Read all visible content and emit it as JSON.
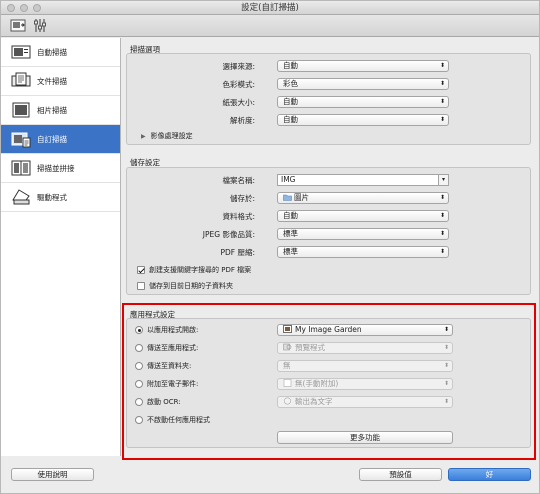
{
  "window": {
    "title": "設定(自訂掃描)"
  },
  "sidebar": {
    "items": [
      {
        "label": "自動掃描"
      },
      {
        "label": "文件掃描"
      },
      {
        "label": "相片掃描"
      },
      {
        "label": "自訂掃描"
      },
      {
        "label": "掃描並拼接"
      },
      {
        "label": "驅動程式"
      }
    ],
    "active_index": 3
  },
  "scan_options": {
    "title": "掃描選項",
    "source": {
      "label": "選擇來源:",
      "value": "自動"
    },
    "color_mode": {
      "label": "色彩模式:",
      "value": "彩色"
    },
    "paper_size": {
      "label": "紙張大小:",
      "value": "自動"
    },
    "resolution": {
      "label": "解析度:",
      "value": "自動"
    },
    "image_processing": "影像處理設定"
  },
  "save_settings": {
    "title": "儲存設定",
    "file_name": {
      "label": "檔案名稱:",
      "value": "IMG"
    },
    "save_in": {
      "label": "儲存於:",
      "value": "圖片"
    },
    "data_format": {
      "label": "資料格式:",
      "value": "自動"
    },
    "jpeg_quality": {
      "label": "JPEG 影像品質:",
      "value": "標準"
    },
    "pdf_compression": {
      "label": "PDF 壓縮:",
      "value": "標準"
    },
    "keyword_pdf": {
      "label": "創建支援關鍵字搜尋的 PDF 檔案",
      "checked": true
    },
    "date_subfolder": {
      "label": "儲存到目前日期的子資料夾",
      "checked": false
    }
  },
  "app_settings": {
    "title": "應用程式設定",
    "open_with": {
      "label": "以應用程式開啟:",
      "value": "My Image Garden",
      "selected": true
    },
    "send_to_app": {
      "label": "傳送至應用程式:",
      "value": "預覽程式"
    },
    "send_to_folder": {
      "label": "傳送至資料夾:",
      "value": "無"
    },
    "attach_email": {
      "label": "附加至電子郵件:",
      "value": "無(手動附加)"
    },
    "start_ocr": {
      "label": "啟動 OCR:",
      "value": "輸出為文字"
    },
    "no_app": {
      "label": "不啟動任何應用程式"
    },
    "more_functions": "更多功能"
  },
  "footer": {
    "help": "使用說明",
    "defaults": "預設值",
    "ok": "好"
  }
}
